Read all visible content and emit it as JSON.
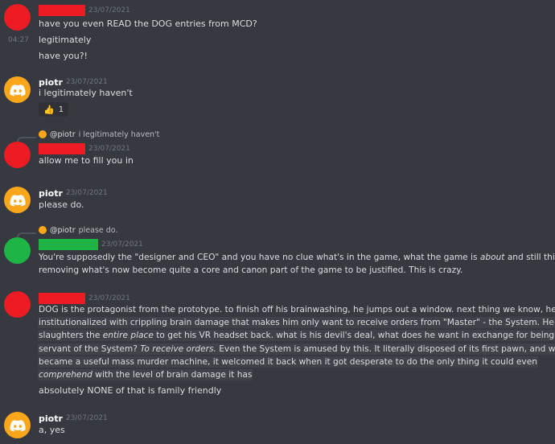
{
  "messages": {
    "m1": {
      "time": "23/07/2021",
      "lines": [
        "have you even READ the DOG entries from MCD?",
        "legitimately",
        "have you?!"
      ],
      "side_time": "04:27"
    },
    "m2": {
      "user": "piotr",
      "time": "23/07/2021",
      "text": "i legitimately haven't",
      "reaction_count": "1",
      "reaction_icon": "thumbs-up-icon"
    },
    "m3": {
      "reply_user": "@piotr",
      "reply_text": "i legitimately haven't",
      "time": "23/07/2021",
      "text": "allow me to fill you in"
    },
    "m4": {
      "user": "piotr",
      "time": "23/07/2021",
      "text": "please do."
    },
    "m5": {
      "reply_user": "@piotr",
      "reply_text": "please do.",
      "time": "23/07/2021",
      "text_a": "You're supposedly the \"designer and CEO\" and you have no clue what's in the game, what the game is ",
      "text_em": "about",
      "text_b": " and still think",
      "text_line2": "removing what's now become quite a core and canon part of the game to be justified. This is crazy."
    },
    "m6": {
      "time": "23/07/2021",
      "l1": "DOG is the protagonist from the prototype. to finish off his brainwashing, he jumps out a window. next thing we know, he's",
      "l2": "institutionalized with crippling brain damage that makes him only want to receive orders from \"Master\" - the System. He likely",
      "l3a": "slaughters the ",
      "l3em": "entire place",
      "l3b": " to get his VR headset back. what is his devil's deal, what does he want in exchange for being a",
      "l4a": "servant of the System? ",
      "l4em": "To receive orders.",
      "l4b": " Even the System is amused by this. It literally disposed of its first pawn, and when it",
      "l5": "became a useful mass murder machine, it welcomed it back when it got desperate to do the only thing it could even",
      "l6em": "comprehend",
      "l6b": " with the level of brain damage it has",
      "l7": "absolutely NONE of that is family friendly"
    },
    "m7": {
      "user": "piotr",
      "time": "23/07/2021",
      "text": "a, yes"
    }
  },
  "colors": {
    "background": "#36393f",
    "redaction_red": "#ec1b24",
    "redaction_green": "#1eb446",
    "discord_avatar": "#faa61a"
  }
}
